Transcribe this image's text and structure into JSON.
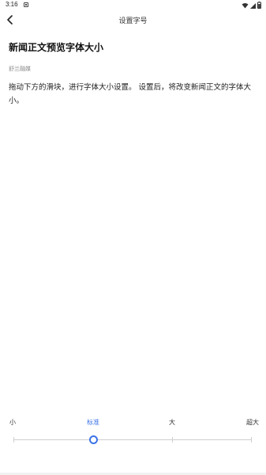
{
  "status_bar": {
    "time": "3:16",
    "icons": [
      "notification-icon",
      "wifi-icon",
      "signal-icon",
      "battery-icon"
    ]
  },
  "nav": {
    "back_icon": "chevron-left-icon",
    "title": "设置字号"
  },
  "article": {
    "title": "新闻正文预览字体大小",
    "source": "舒兰融媒",
    "body": "拖动下方的滑块，进行字体大小设置。 设置后，将改变新闻正文的字体大小。"
  },
  "font_slider": {
    "options": [
      "小",
      "标准",
      "大",
      "超大"
    ],
    "selected_index": 1,
    "selected_label": "标准",
    "accent_color": "#3b73e6"
  }
}
